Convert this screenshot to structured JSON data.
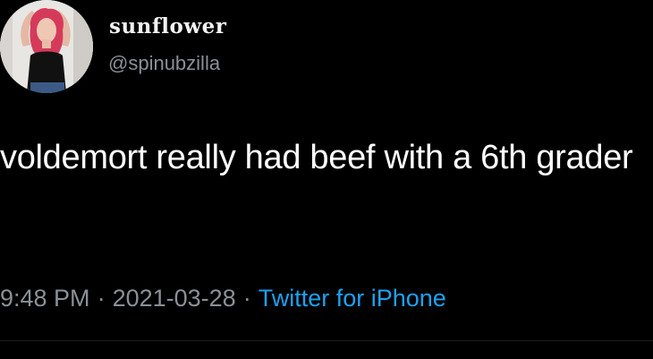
{
  "tweet": {
    "author": {
      "display_name": "sunflower",
      "handle": "@spinubzilla"
    },
    "text": "voldemort really had beef with a 6th grader",
    "meta": {
      "time": "9:48 PM",
      "separator": "·",
      "date": "2021-03-28",
      "source": "Twitter for iPhone"
    }
  },
  "colors": {
    "background": "#000000",
    "text_primary": "#ffffff",
    "text_secondary": "#8a9097",
    "link": "#1da1f2"
  }
}
